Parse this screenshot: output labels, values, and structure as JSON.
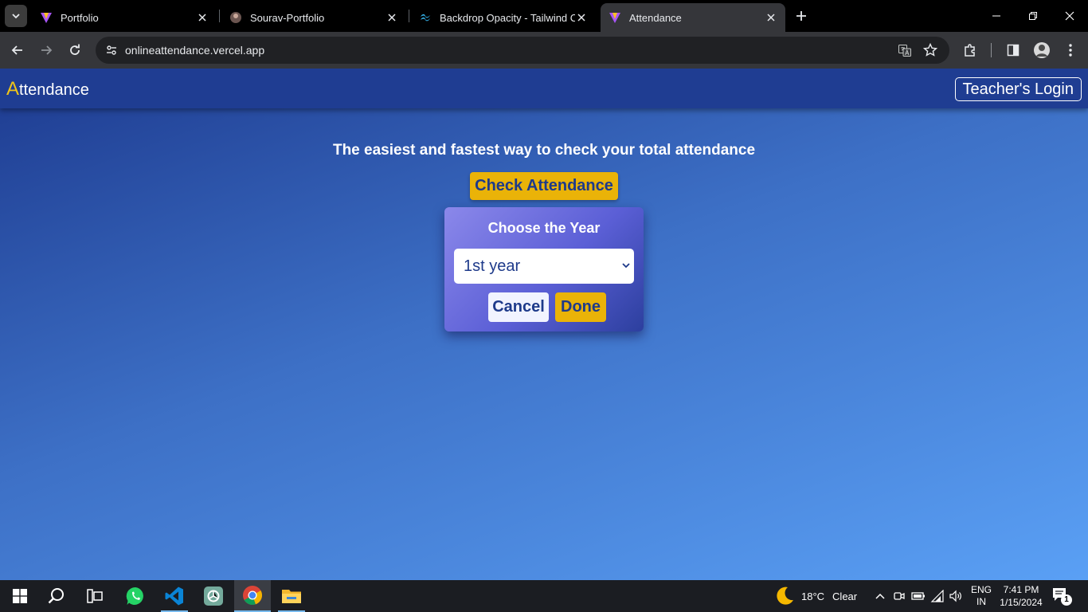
{
  "browser": {
    "tabs": [
      {
        "title": "Portfolio",
        "favicon": "vite-logo-icon",
        "active": false
      },
      {
        "title": "Sourav-Portfolio",
        "favicon": "avatar-favicon-icon",
        "active": false
      },
      {
        "title": "Backdrop Opacity - Tailwind CSS",
        "favicon": "tailwind-logo-icon",
        "active": false
      },
      {
        "title": "Attendance",
        "favicon": "vite-logo-icon",
        "active": true
      }
    ],
    "url": "onlineattendance.vercel.app"
  },
  "page": {
    "brand_first": "A",
    "brand_rest": "ttendance",
    "teacher_login": "Teacher's Login",
    "headline": "The easiest and fastest way to check your total attendance",
    "check_button": "Check Attendance",
    "modal": {
      "title": "Choose the Year",
      "selected_year": "1st year",
      "cancel": "Cancel",
      "done": "Done"
    },
    "colors": {
      "accent": "#eab308",
      "navbar": "#1f3d92",
      "text_dark": "#1e3a8a"
    }
  },
  "taskbar": {
    "apps": [
      "windows-start-icon",
      "search-icon",
      "task-view-icon",
      "whatsapp-icon",
      "vscode-icon",
      "chatgpt-icon",
      "chrome-icon",
      "file-explorer-icon"
    ],
    "weather": {
      "temp": "18°C",
      "condition": "Clear"
    },
    "language": {
      "line1": "ENG",
      "line2": "IN"
    },
    "clock": {
      "time": "7:41 PM",
      "date": "1/15/2024"
    },
    "notifications": "1"
  }
}
